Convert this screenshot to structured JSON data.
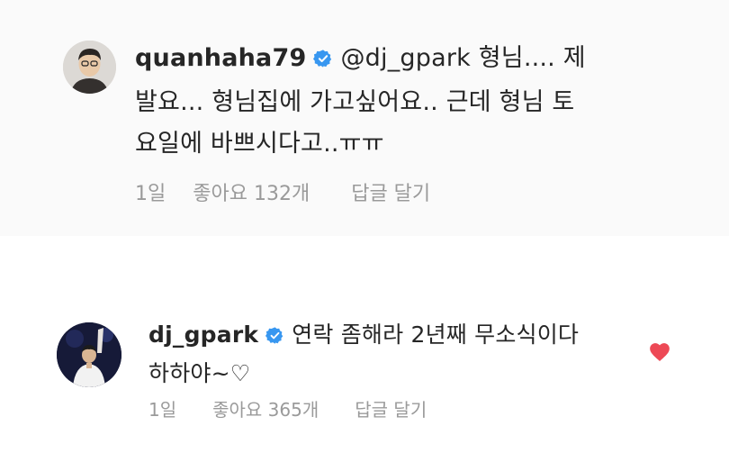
{
  "comments": [
    {
      "username": "quanhaha79",
      "verified": true,
      "mention": "@dj_gpark",
      "text": "형님.... 제발요... 형님집에 가고싶어요.. 근데 형님 토요일에 바쁘시다고..ㅠㅠ",
      "line1_rest": "형님.... 제",
      "line2": "발요... 형님집에 가고싶어요.. 근데 형님 토",
      "line3": "요일에 바쁘시다고..ㅠㅠ",
      "time": "1일",
      "likes": "좋아요 132개",
      "reply": "답글 달기"
    },
    {
      "username": "dj_gpark",
      "verified": true,
      "line1_rest": "연락 좀해라 2년째 무소식이다",
      "line2": "하하야~♡",
      "time": "1일",
      "likes": "좋아요 365개",
      "reply": "답글 달기",
      "liked": true,
      "heart_color": "#ed4956"
    }
  ],
  "icons": {
    "verified": "verified-badge-icon",
    "heart": "heart-icon",
    "verified_color": "#3897f0"
  }
}
